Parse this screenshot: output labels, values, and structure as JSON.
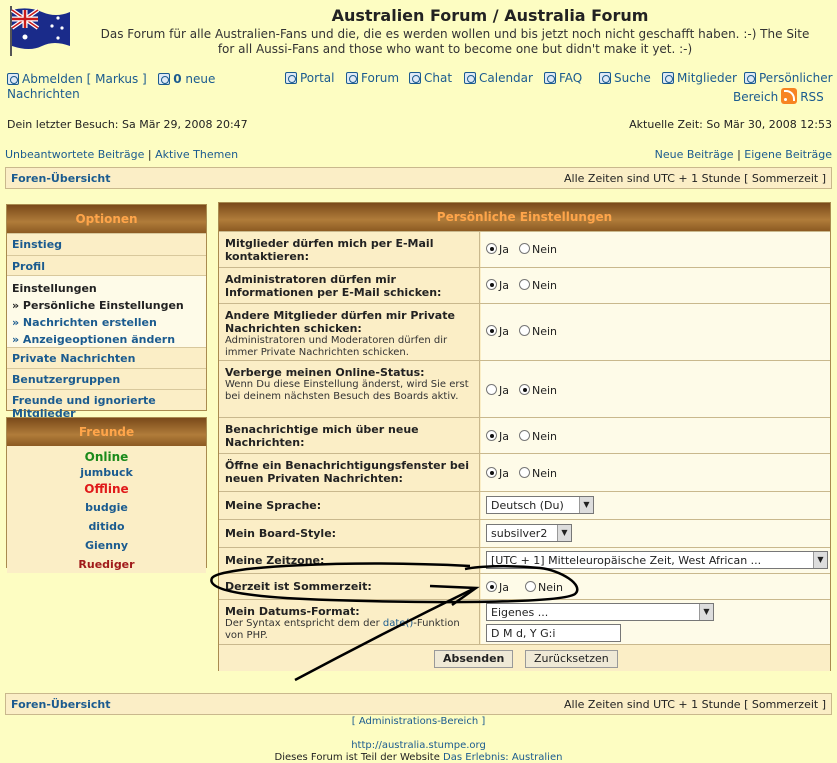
{
  "header": {
    "title": "Australien Forum / Australia Forum",
    "desc_line1": "Das Forum für alle Australien-Fans und die, die es werden wollen und bis jetzt noch nicht geschafft haben. :-) The Site",
    "desc_line2": "for all Aussi-Fans and those who want to become one but didn't make it yet. :-)"
  },
  "topnav": {
    "logout": "Abmelden [ Markus ]",
    "new_count": "0",
    "new_msgs_a": "neue",
    "new_msgs_b": "Nachrichten",
    "portal": "Portal",
    "forum": "Forum",
    "chat": "Chat",
    "calendar": "Calendar",
    "faq": "FAQ",
    "search": "Suche",
    "members": "Mitglieder",
    "personal_a": "Persönlicher",
    "personal_b": "Bereich",
    "rss": "RSS"
  },
  "visit": {
    "last": "Dein letzter Besuch: Sa Mär 29, 2008 20:47",
    "current": "Aktuelle Zeit: So Mär 30, 2008 12:53"
  },
  "quicklinks": {
    "unanswered": "Unbeantwortete Beiträge",
    "sep": "|",
    "active": "Aktive Themen",
    "new_posts": "Neue Beiträge",
    "own_posts": "Eigene Beiträge"
  },
  "breadcrumb": {
    "index": "Foren-Übersicht",
    "tz": "Alle Zeiten sind UTC + 1 Stunde [ Sommerzeit ]"
  },
  "sidebar": {
    "title": "Optionen",
    "items": [
      {
        "label": "Einstieg"
      },
      {
        "label": "Profil"
      },
      {
        "label": "Einstellungen"
      },
      {
        "label": "» Persönliche Einstellungen"
      },
      {
        "label": "» Nachrichten erstellen"
      },
      {
        "label": "» Anzeigeoptionen ändern"
      },
      {
        "label": "Private Nachrichten"
      },
      {
        "label": "Benutzergruppen"
      },
      {
        "label": "Freunde und ignorierte Mitglieder"
      }
    ]
  },
  "friends": {
    "title": "Freunde",
    "online_label": "Online",
    "online": [
      "jumbuck"
    ],
    "offline_label": "Offline",
    "offline": [
      "budgie",
      "ditido",
      "Gienny",
      "Ruediger"
    ]
  },
  "form": {
    "title": "Persönliche Einstellungen",
    "yes": "Ja",
    "no": "Nein",
    "rows": [
      {
        "label": "Mitglieder dürfen mich per E-Mail kontaktieren:",
        "hint": ""
      },
      {
        "label": "Administratoren dürfen mir Informationen per E-Mail schicken:",
        "hint": ""
      },
      {
        "label": "Andere Mitglieder dürfen mir Private Nachrichten schicken:",
        "hint": "Administratoren und Moderatoren dürfen dir immer Private Nachrichten schicken."
      },
      {
        "label": "Verberge meinen Online-Status:",
        "hint": "Wenn Du diese Einstellung änderst, wird Sie erst bei deinem nächsten Besuch des Boards aktiv."
      },
      {
        "label": "Benachrichtige mich über neue Nachrichten:",
        "hint": ""
      },
      {
        "label": "Öffne ein Benachrichtigungsfenster bei neuen Privaten Nachrichten:",
        "hint": ""
      }
    ],
    "language_label": "Meine Sprache:",
    "language_value": "Deutsch (Du)",
    "style_label": "Mein Board-Style:",
    "style_value": "subsilver2",
    "timezone_label": "Meine Zeitzone:",
    "timezone_value": "[UTC + 1] Mitteleuropäische Zeit, West African ...",
    "dst_label": "Derzeit ist Sommerzeit:",
    "dateformat_label": "Mein Datums-Format:",
    "dateformat_hint_a": "Der Syntax entspricht dem der",
    "dateformat_hint_link": "date()",
    "dateformat_hint_b": "-Funktion von PHP.",
    "dateformat_value": "Eigenes ...",
    "dateformat_custom": "D M d, Y G:i",
    "submit": "Absenden",
    "reset": "Zurücksetzen"
  },
  "footer": {
    "admin": "[ Administrations-Bereich ]",
    "url": "http://australia.stumpe.org",
    "part_of": "Dieses Forum ist Teil der Website",
    "site_link": "Das Erlebnis: Australien"
  }
}
